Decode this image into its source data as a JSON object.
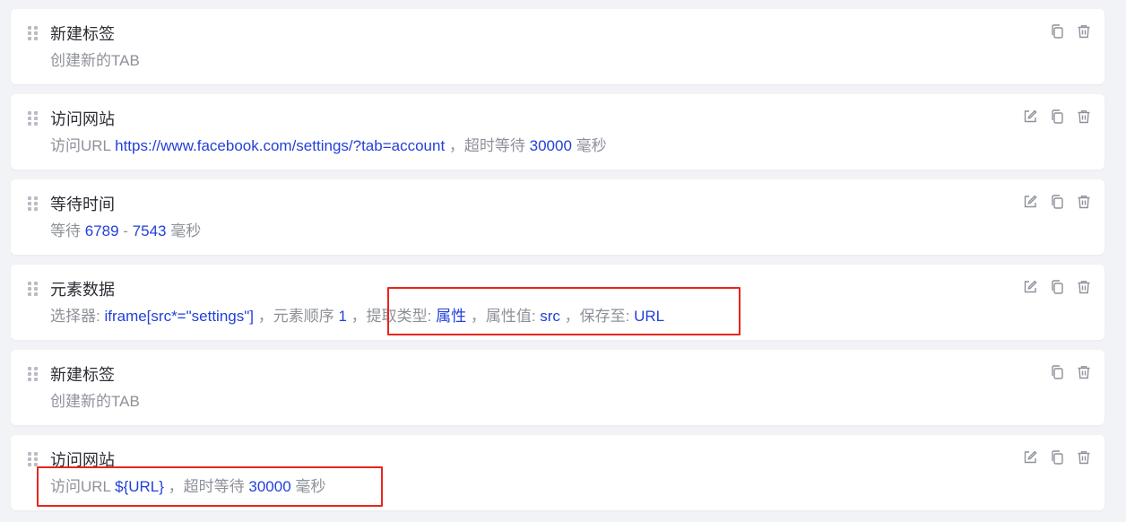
{
  "steps": [
    {
      "title": "新建标签",
      "desc": [
        {
          "t": "g",
          "s": "创建新的TAB"
        }
      ],
      "actions": [
        "copy-icon",
        "delete-icon"
      ]
    },
    {
      "title": "访问网站",
      "desc": [
        {
          "t": "g",
          "s": "访问URL "
        },
        {
          "t": "v",
          "s": "https://www.facebook.com/settings/?tab=account"
        },
        {
          "t": "g",
          "s": " ，超时等待 "
        },
        {
          "t": "v",
          "s": "30000"
        },
        {
          "t": "g",
          "s": " 毫秒"
        }
      ],
      "actions": [
        "edit-icon",
        "copy-icon",
        "delete-icon"
      ]
    },
    {
      "title": "等待时间",
      "desc": [
        {
          "t": "g",
          "s": "等待 "
        },
        {
          "t": "v",
          "s": "6789"
        },
        {
          "t": "g",
          "s": " - "
        },
        {
          "t": "v",
          "s": "7543"
        },
        {
          "t": "g",
          "s": " 毫秒"
        }
      ],
      "actions": [
        "edit-icon",
        "copy-icon",
        "delete-icon"
      ]
    },
    {
      "title": "元素数据",
      "desc": [
        {
          "t": "g",
          "s": "选择器: "
        },
        {
          "t": "v",
          "s": "iframe[src*=\"settings\"]"
        },
        {
          "t": "g",
          "s": " ，元素顺序 "
        },
        {
          "t": "v",
          "s": "1"
        },
        {
          "t": "g",
          "s": " ，提取类型: "
        },
        {
          "t": "v",
          "s": "属性"
        },
        {
          "t": "g",
          "s": " ，属性值: "
        },
        {
          "t": "v",
          "s": "src"
        },
        {
          "t": "g",
          "s": " ，保存至: "
        },
        {
          "t": "v",
          "s": "URL"
        }
      ],
      "actions": [
        "edit-icon",
        "copy-icon",
        "delete-icon"
      ]
    },
    {
      "title": "新建标签",
      "desc": [
        {
          "t": "g",
          "s": "创建新的TAB"
        }
      ],
      "actions": [
        "copy-icon",
        "delete-icon"
      ]
    },
    {
      "title": "访问网站",
      "desc": [
        {
          "t": "g",
          "s": "访问URL "
        },
        {
          "t": "v",
          "s": "${URL}"
        },
        {
          "t": "g",
          "s": " ，超时等待 "
        },
        {
          "t": "v",
          "s": "30000"
        },
        {
          "t": "g",
          "s": " 毫秒"
        }
      ],
      "actions": [
        "edit-icon",
        "copy-icon",
        "delete-icon"
      ]
    }
  ],
  "colors": {
    "background": "#f2f3f6",
    "card": "#ffffff",
    "title_text": "#2b2d33",
    "muted_text": "#8e9199",
    "value_text": "#2340d8",
    "icon": "#8e9199",
    "highlight": "#e8251d"
  }
}
